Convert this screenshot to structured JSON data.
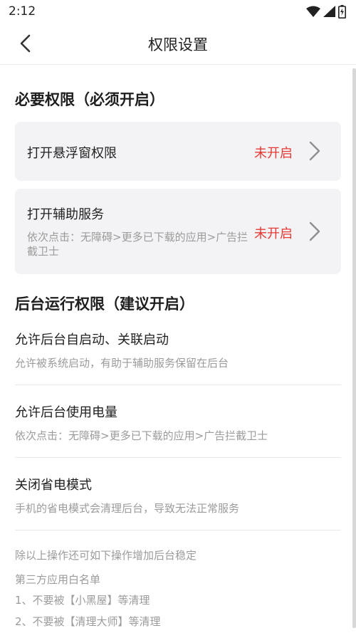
{
  "status_bar": {
    "time": "2:12",
    "icons": [
      "wifi-icon",
      "signal-icon",
      "battery-icon"
    ]
  },
  "nav": {
    "back_icon": "chevron-left-icon",
    "title": "权限设置"
  },
  "required_section": {
    "title": "必要权限（必须开启）",
    "cards": [
      {
        "title": "打开悬浮窗权限",
        "desc": "",
        "status": "未开启"
      },
      {
        "title": "打开辅助服务",
        "desc": "依次点击：无障碍>更多已下载的应用>广告拦截卫士",
        "status": "未开启"
      }
    ]
  },
  "background_section": {
    "title": "后台运行权限（建议开启）",
    "rows": [
      {
        "title": "允许后台自启动、关联启动",
        "desc": "允许被系统启动，有助于辅助服务保留在后台"
      },
      {
        "title": "允许后台使用电量",
        "desc": "依次点击：无障碍>更多已下载的应用>广告拦截卫士"
      },
      {
        "title": "关闭省电模式",
        "desc": "手机的省电模式会清理后台，导致无法正常服务"
      }
    ]
  },
  "notes": [
    "除以上操作还可如下操作增加后台稳定",
    "第三方应用白名单",
    "1、不要被【小黑屋】等清理",
    "2、不要被【清理大师】等清理"
  ],
  "colors": {
    "status_red": "#e53935",
    "card_bg": "#f3f3f5",
    "desc_gray": "#9b9b9b"
  }
}
